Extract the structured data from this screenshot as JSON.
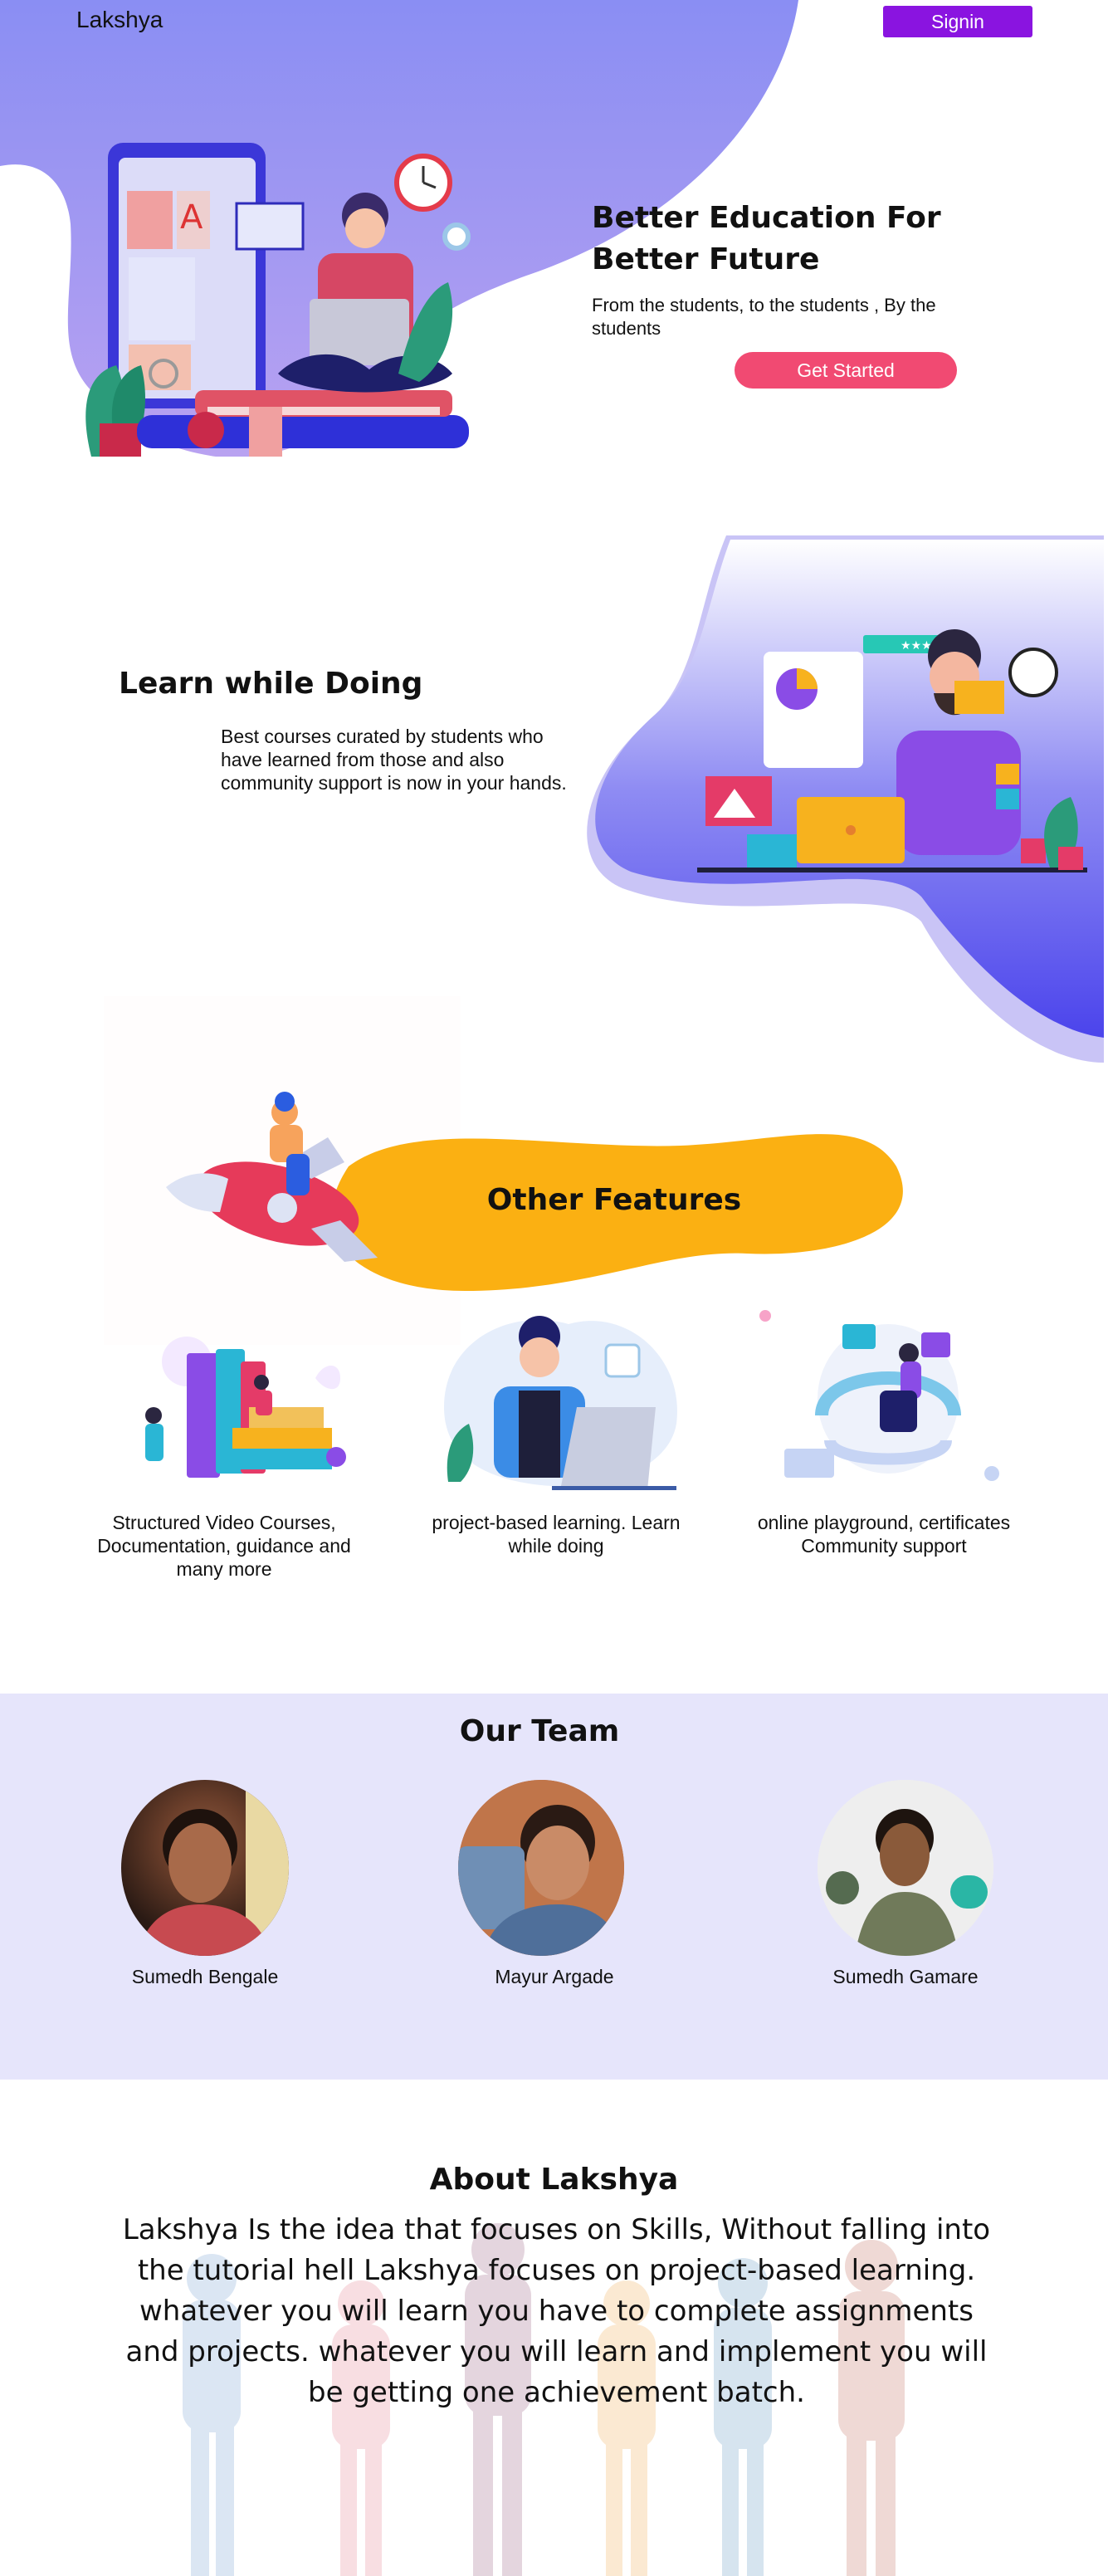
{
  "nav": {
    "brand": "Lakshya",
    "signin_label": "Signin"
  },
  "hero": {
    "title": "Better Education For Better Future",
    "subtitle": "From the students, to the students , By the students",
    "cta_label": "Get Started"
  },
  "learn": {
    "title": "Learn while Doing",
    "body": "Best courses curated by students who have learned from those and also community support is now in your hands."
  },
  "features": {
    "title": "Other Features",
    "items": [
      {
        "caption": "Structured Video Courses, Documentation, guidance and many more"
      },
      {
        "caption": "project-based learning. Learn while doing"
      },
      {
        "caption": "online playground, certificates Community support"
      }
    ]
  },
  "team": {
    "title": "Our Team",
    "members": [
      {
        "name": "Sumedh Bengale"
      },
      {
        "name": "Mayur Argade"
      },
      {
        "name": "Sumedh Gamare"
      }
    ]
  },
  "about": {
    "title": "About Lakshya",
    "body": "Lakshya Is the idea that focuses on Skills, Without falling into the tutorial hell Lakshya focuses on project-based learning. whatever you will learn you have to complete assignments and projects. whatever you will learn and implement you will be getting one achievement batch."
  },
  "colors": {
    "hero_gradient_top": "#8b8ef2",
    "hero_gradient_bottom": "#b39af0",
    "signin_button": "#8a14e0",
    "cta_button": "#f14a72",
    "feature_banner": "#fbb012",
    "team_background": "#e6e5fb",
    "learn_blob": "#5a55ee"
  },
  "icons": {
    "hero_illustration": "student-laptop-books-illustration",
    "learn_illustration": "teacher-desk-illustration",
    "rocket": "rocket-illustration",
    "feature_1": "books-stack-illustration",
    "feature_2": "developer-laptop-illustration",
    "feature_3": "vr-playground-illustration"
  }
}
